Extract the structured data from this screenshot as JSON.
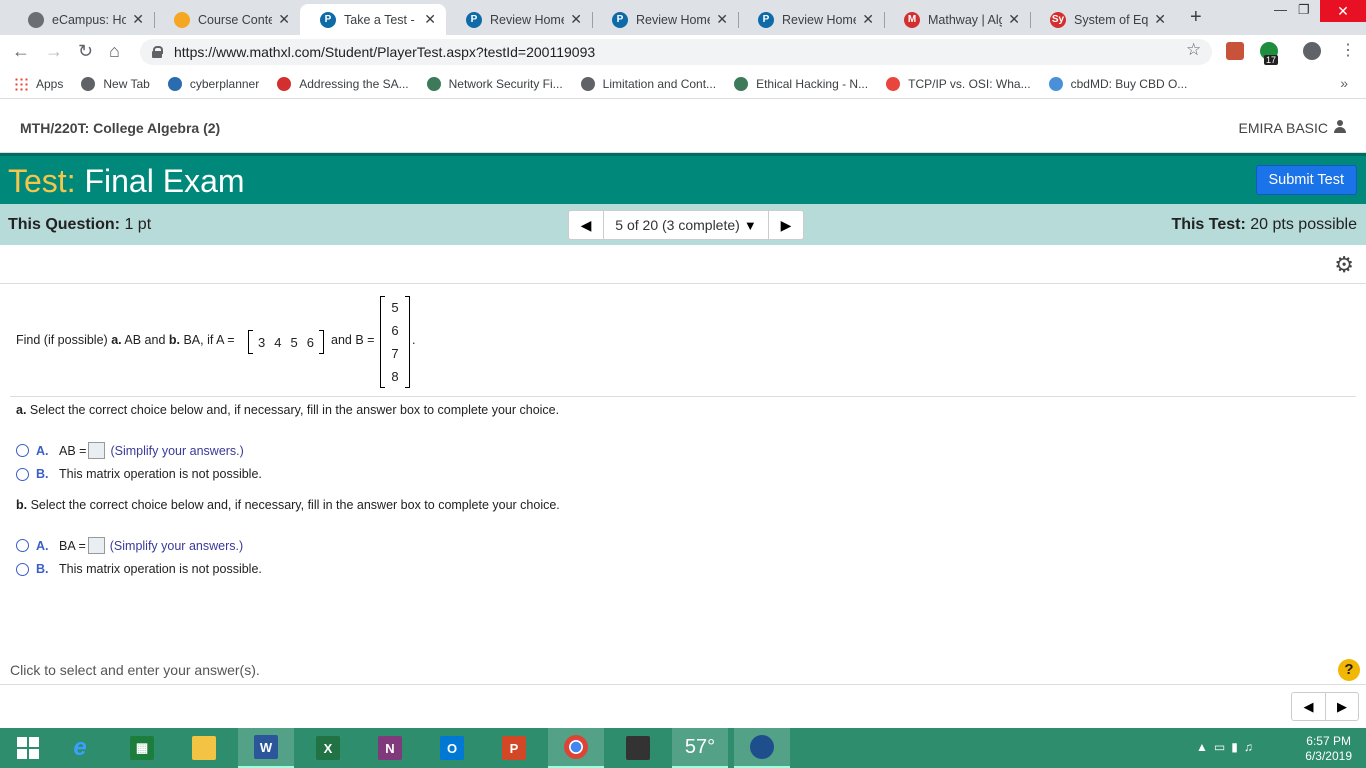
{
  "browser": {
    "tabs": [
      {
        "label": "eCampus: Hom",
        "color": "#6b6f73",
        "glyph": ""
      },
      {
        "label": "Course Content",
        "color": "#f5a623",
        "glyph": ""
      },
      {
        "label": "Take a Test - El",
        "color": "#0f6ba8",
        "glyph": "P",
        "active": true
      },
      {
        "label": "Review Homew",
        "color": "#0f6ba8",
        "glyph": "P"
      },
      {
        "label": "Review Homew",
        "color": "#0f6ba8",
        "glyph": "P"
      },
      {
        "label": "Review Homew",
        "color": "#0f6ba8",
        "glyph": "P"
      },
      {
        "label": "Mathway | Alge",
        "color": "#d32f2f",
        "glyph": "M"
      },
      {
        "label": "System of Equa",
        "color": "#d32f2f",
        "glyph": "Sy"
      }
    ],
    "url": "https://www.mathxl.com/Student/PlayerTest.aspx?testId=200119093",
    "extension_badge": "17",
    "bookmarks": [
      "Apps",
      "New Tab",
      "cyberplanner",
      "Addressing the SA...",
      "Network Security Fi...",
      "Limitation and Cont...",
      "Ethical Hacking - N...",
      "TCP/IP vs. OSI: Wha...",
      "cbdMD: Buy CBD O..."
    ]
  },
  "header": {
    "course": "MTH/220T: College Algebra (2)",
    "user": "EMIRA BASIC"
  },
  "banner": {
    "prefix": "Test:",
    "title": "Final Exam",
    "submit_label": "Submit Test"
  },
  "qbar": {
    "question_label": "This Question:",
    "question_points": "1 pt",
    "nav_text": "5 of 20 (3 complete)",
    "test_label": "This Test:",
    "test_points": "20 pts possible"
  },
  "question": {
    "text_pre": "Find (if possible) ",
    "a_bold": "a.",
    "text_mid1": " AB and ",
    "b_bold": "b.",
    "text_mid2": " BA, if A =",
    "text_and": "and B =",
    "period": ".",
    "matrix_a": [
      "3",
      "4",
      "5",
      "6"
    ],
    "matrix_b": [
      "5",
      "6",
      "7",
      "8"
    ]
  },
  "part_a": {
    "prompt_letter": "a.",
    "prompt": " Select the correct choice below and, if necessary, fill in the answer box to complete your choice.",
    "choice_a_letter": "A.",
    "choice_a_text": "AB =",
    "choice_a_hint": "(Simplify your answers.)",
    "choice_b_letter": "B.",
    "choice_b_text": "This matrix operation is not possible."
  },
  "part_b": {
    "prompt_letter": "b.",
    "prompt": " Select the correct choice below and, if necessary, fill in the answer box to complete your choice.",
    "choice_a_letter": "A.",
    "choice_a_text": "BA =",
    "choice_a_hint": "(Simplify your answers.)",
    "choice_b_letter": "B.",
    "choice_b_text": "This matrix operation is not possible."
  },
  "footer": {
    "hint": "Click to select and enter your answer(s).",
    "help": "?"
  },
  "taskbar": {
    "temperature": "57°",
    "time": "6:57 PM",
    "date": "6/3/2019"
  }
}
